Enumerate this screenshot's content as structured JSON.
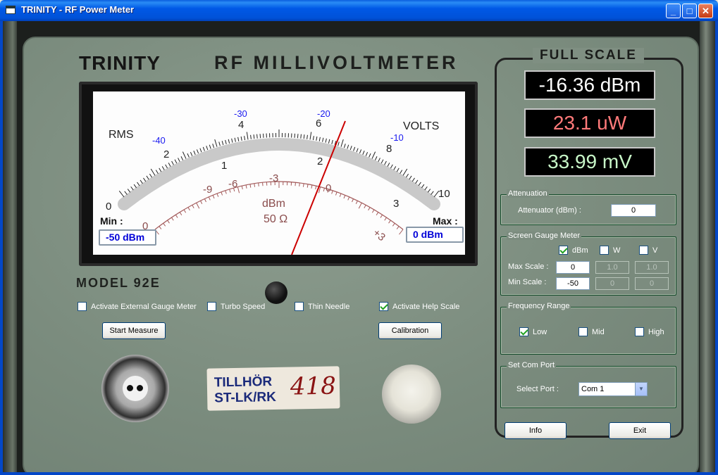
{
  "window": {
    "title": "TRINITY - RF Power Meter"
  },
  "panel": {
    "brand": "TRINITY",
    "subtitle": "RF  MILLIVOLTMETER",
    "model": "MODEL 92E"
  },
  "dial": {
    "rms_label": "RMS",
    "volts_label": "VOLTS",
    "volt_ticks": [
      "0",
      "2",
      "4",
      "6",
      "8",
      "10"
    ],
    "volt_minor_ticks": [
      "1",
      "2",
      "3"
    ],
    "dbm_blue_ticks": [
      "-40",
      "-30",
      "-20",
      "-10"
    ],
    "dbm_red_ticks": [
      "0",
      "-9",
      "-6",
      "-3",
      "0",
      "+3"
    ],
    "dbm_center_label": "dBm",
    "ohm_label": "50 Ω",
    "needle_value_dbm": -16.36
  },
  "minmax": {
    "min_label": "Min :",
    "min_value": "-50 dBm",
    "max_label": "Max :",
    "max_value": "0 dBm"
  },
  "options": {
    "external_gauge": {
      "label": "Activate External Gauge Meter",
      "checked": false
    },
    "turbo_speed": {
      "label": "Turbo Speed",
      "checked": false
    },
    "thin_needle": {
      "label": "Thin Needle",
      "checked": false
    },
    "help_scale": {
      "label": "Activate Help Scale",
      "checked": true
    }
  },
  "buttons": {
    "start_measure": "Start Measure",
    "calibration": "Calibration",
    "info": "Info",
    "exit": "Exit"
  },
  "sticker": {
    "line1": "TILLHÖR",
    "line2": "ST-LK/RK",
    "number": "418"
  },
  "full_scale": {
    "title": "FULL SCALE",
    "dbm": "-16.36 dBm",
    "watts": "23.1 uW",
    "volts": "33.99 mV",
    "colors": {
      "dbm": "#ffffff",
      "watts": "#ff7a7a",
      "volts": "#c8f7c8"
    }
  },
  "attenuation": {
    "legend": "Attenuation",
    "label": "Attenuator (dBm) :",
    "value": "0"
  },
  "gauge": {
    "legend": "Screen Gauge Meter",
    "units": [
      {
        "label": "dBm",
        "checked": true
      },
      {
        "label": "W",
        "checked": false
      },
      {
        "label": "V",
        "checked": false
      }
    ],
    "max_label": "Max Scale :",
    "min_label": "Min Scale :",
    "max_values": [
      "0",
      "1.0",
      "1.0"
    ],
    "min_values": [
      "-50",
      "0",
      "0"
    ]
  },
  "frequency": {
    "legend": "Frequency Range",
    "low": {
      "label": "Low",
      "checked": true
    },
    "mid": {
      "label": "Mid",
      "checked": false
    },
    "high": {
      "label": "High",
      "checked": false
    }
  },
  "com": {
    "legend": "Set Com Port",
    "label": "Select Port :",
    "value": "Com 1"
  }
}
